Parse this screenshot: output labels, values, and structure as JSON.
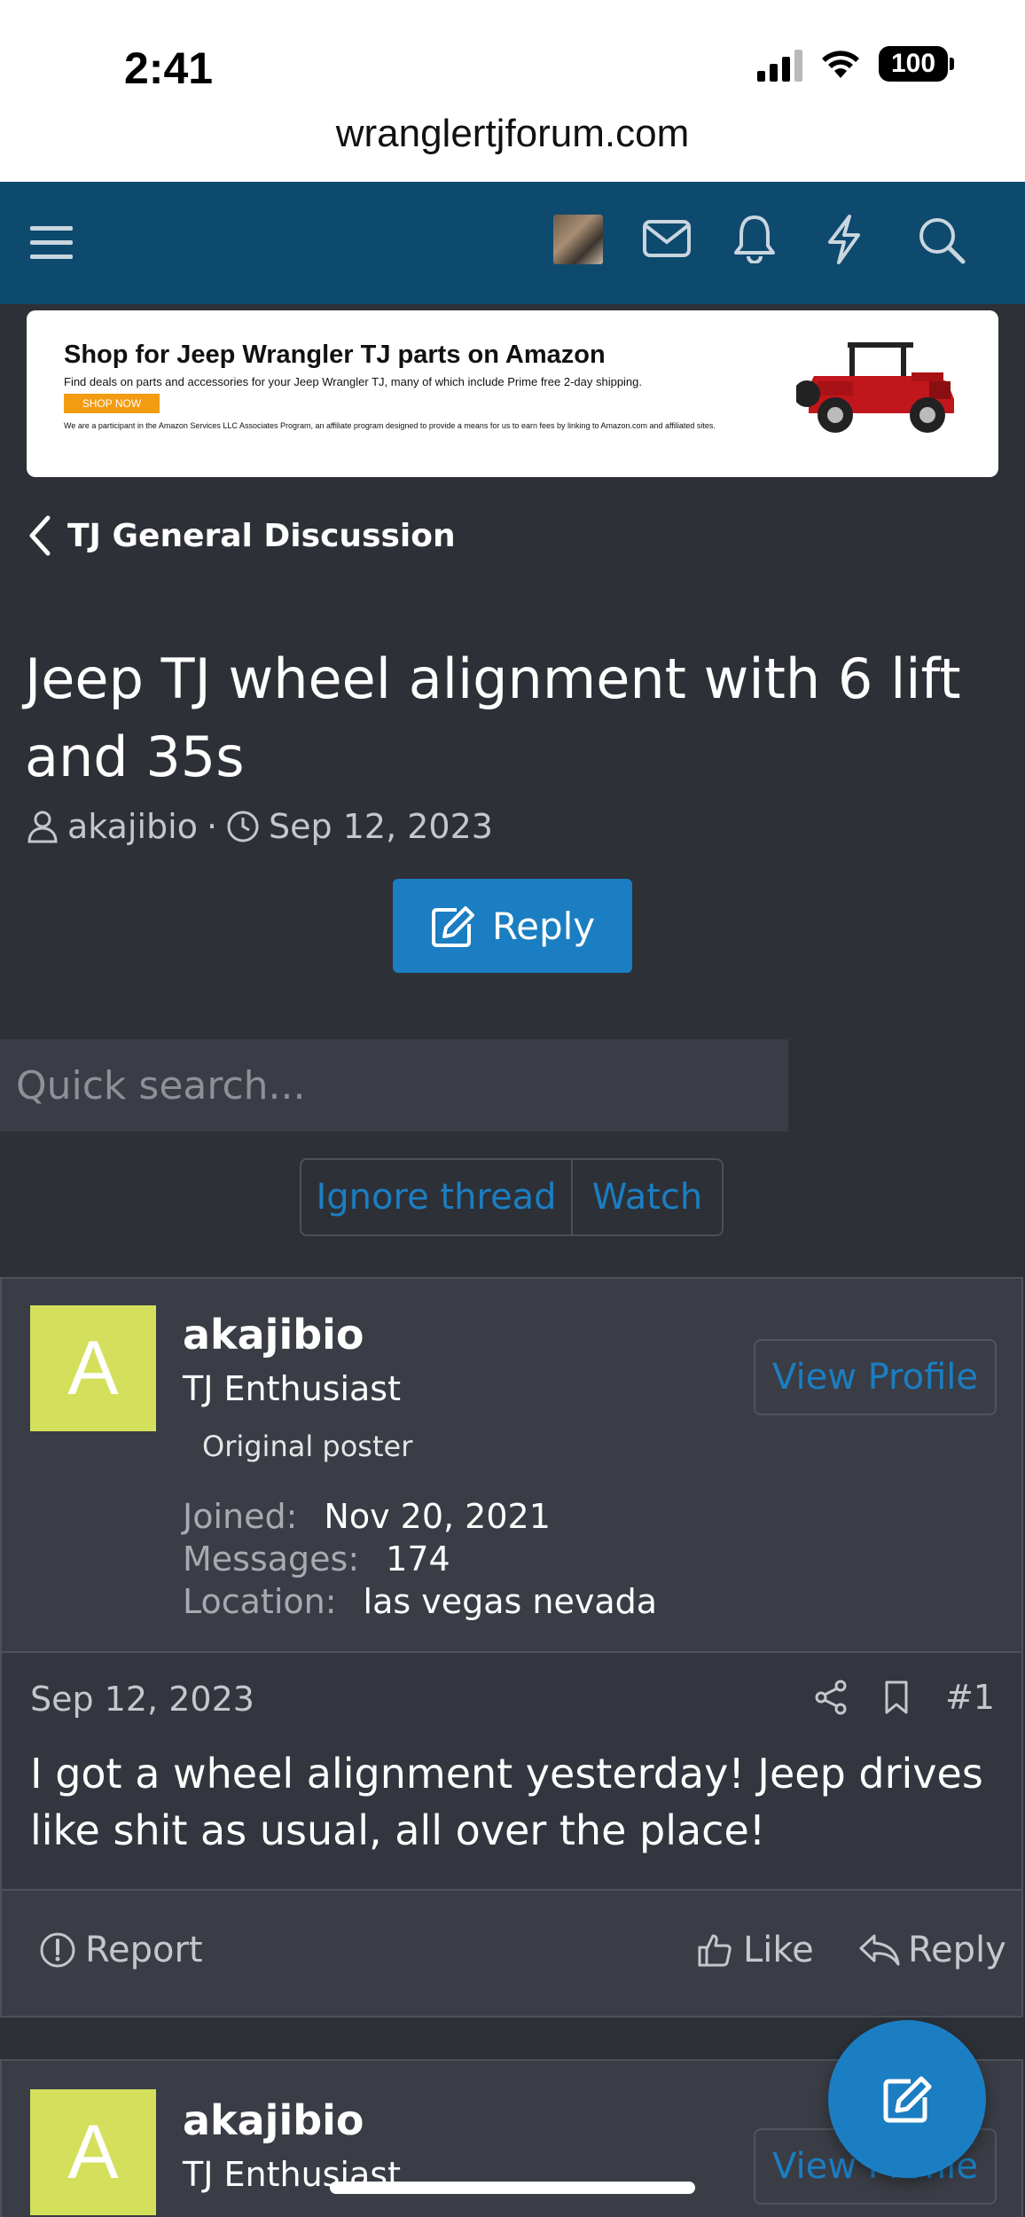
{
  "status_bar": {
    "time": "2:41",
    "battery": "100",
    "url": "wranglertjforum.com"
  },
  "nav": {
    "icons": [
      "menu-icon",
      "user-avatar",
      "mail-icon",
      "bell-icon",
      "lightning-icon",
      "search-icon"
    ]
  },
  "ad": {
    "title": "Shop for Jeep Wrangler TJ parts on Amazon",
    "subtitle": "Find deals on parts and accessories for your Jeep Wrangler TJ, many of which include Prime free 2-day shipping.",
    "button": "SHOP NOW",
    "disclaimer": "We are a participant in the Amazon Services LLC Associates Program, an affiliate program designed to provide a means for us to earn fees by linking to Amazon.com and affiliated sites."
  },
  "breadcrumb": "TJ General Discussion",
  "thread": {
    "title": "Jeep TJ wheel alignment with 6 lift and 35s",
    "author": "akajibio",
    "separator": "·",
    "date": "Sep 12, 2023",
    "reply_label": "Reply"
  },
  "search": {
    "placeholder": "Quick search..."
  },
  "thread_actions": {
    "ignore": "Ignore thread",
    "watch": "Watch"
  },
  "post": {
    "avatar_letter": "A",
    "username": "akajibio",
    "user_title": "TJ Enthusiast",
    "badge": "Original poster",
    "view_profile": "View Profile",
    "stats": [
      {
        "label": "Joined:",
        "value": "Nov 20, 2021"
      },
      {
        "label": "Messages:",
        "value": "174"
      },
      {
        "label": "Location:",
        "value": "las vegas nevada"
      }
    ],
    "date": "Sep 12, 2023",
    "number": "#1",
    "text": "I got a wheel alignment yesterday! Jeep drives like shit as usual, all over the place!",
    "report": "Report",
    "like": "Like",
    "reply": "Reply"
  },
  "post2": {
    "avatar_letter": "A",
    "username": "akajibio",
    "user_title": "TJ Enthusiast",
    "view_profile": "View Profile"
  },
  "colors": {
    "nav_bg": "#0e4a6e",
    "page_bg": "#2d3037",
    "accent": "#1b7ec2",
    "avatar_bg": "#d4df5c"
  }
}
